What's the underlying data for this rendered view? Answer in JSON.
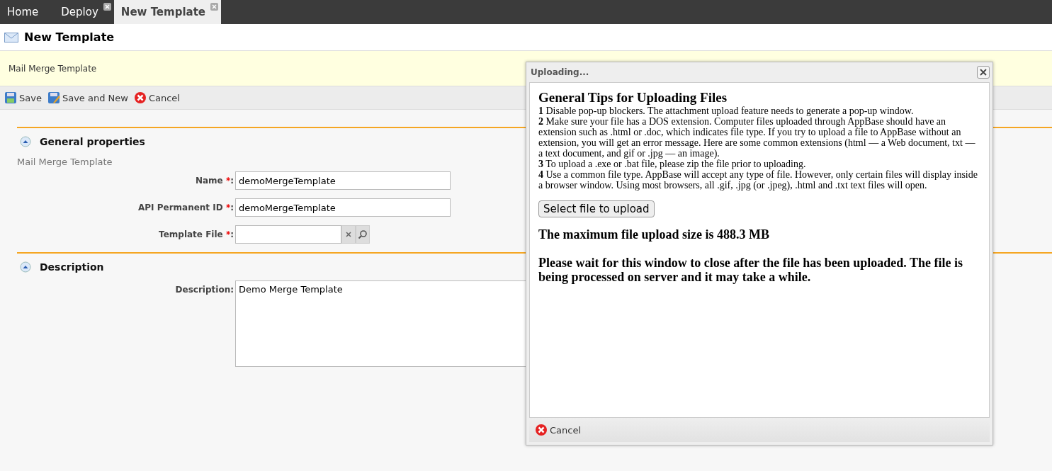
{
  "tabs": [
    {
      "label": "Home",
      "selected": false,
      "closable": false
    },
    {
      "label": "Deploy",
      "selected": false,
      "closable": true
    },
    {
      "label": "New Template",
      "selected": true,
      "closable": true
    }
  ],
  "page_title": "New Template",
  "banner": "Mail Merge Template",
  "toolbar": [
    {
      "kind": "save",
      "label": "Save"
    },
    {
      "kind": "save_new",
      "label": "Save and New"
    },
    {
      "kind": "cancel",
      "label": "Cancel"
    }
  ],
  "sections": [
    {
      "title": "General properties",
      "expanded": true,
      "subtitle": "Mail Merge Template",
      "fields": [
        {
          "kind": "text",
          "label": "Name",
          "required_mark": "*",
          "colon": ":",
          "value": "demoMergeTemplate"
        },
        {
          "kind": "text",
          "label": "API Permanent ID",
          "required_mark": "*",
          "colon": ":",
          "value": "demoMergeTemplate"
        },
        {
          "kind": "lookup",
          "label": "Template File",
          "required_mark": "*",
          "colon": ":"
        }
      ]
    },
    {
      "title": "Description",
      "expanded": true,
      "fields": [
        {
          "kind": "textarea",
          "label": "Description",
          "colon": ":",
          "value": "Demo Merge Template"
        }
      ]
    }
  ],
  "dialog": {
    "title": "Uploading...",
    "heading": "General Tips for Uploading Files",
    "tips": [
      "**1**  Disable pop-up blockers. The attachment upload feature needs to generate a pop-up window.",
      "**2**  Make sure your file has a DOS extension. Computer files uploaded through AppBase should have an extension such as .html or .doc, which indicates file type. If you try to upload a file to AppBase without an extension, you will get an error message. Here are some common extensions (html — a Web document, txt — a text document, and gif or .jpg — an image).",
      "**3**  To upload a .exe or .bat file, please zip the file prior to uploading.",
      "**4**  Use a common file type. AppBase will accept any type of file. However, only certain files will display inside a browser window. Using most browsers, all .gif, .jpg (or .jpeg), .html and .txt text files will open."
    ],
    "select_button": "Select file to upload",
    "notes": [
      "The maximum file upload size is 488.3 MB",
      "Please wait for this window to close after the file has been uploaded. The file is being processed on server and it may take a while."
    ],
    "footer_button": "Cancel"
  }
}
